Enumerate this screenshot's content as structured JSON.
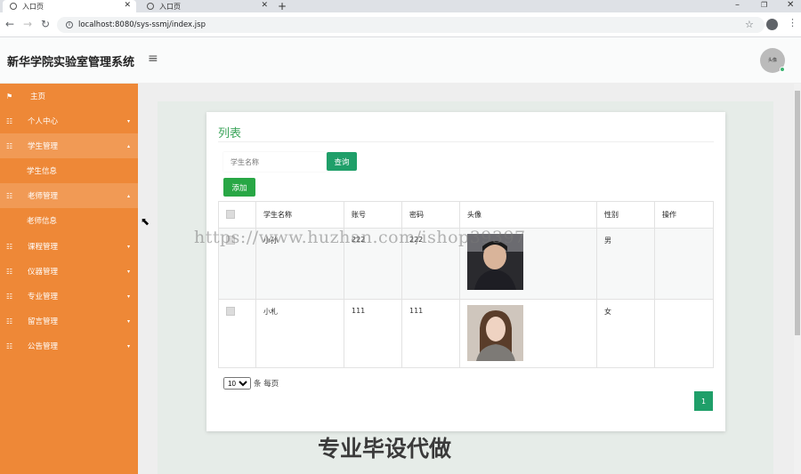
{
  "browser": {
    "tabs": [
      {
        "title": "入口页"
      },
      {
        "title": "入口页"
      }
    ],
    "url": "localhost:8080/sys-ssmj/index.jsp"
  },
  "header": {
    "title": "新华学院实验室管理系统",
    "avatar_text": "头像"
  },
  "sidebar": {
    "items": [
      {
        "label": "主页"
      },
      {
        "label": "个人中心"
      },
      {
        "label": "学生管理"
      },
      {
        "label": "学生信息"
      },
      {
        "label": "老师管理"
      },
      {
        "label": "老师信息"
      },
      {
        "label": "课程管理"
      },
      {
        "label": "仪器管理"
      },
      {
        "label": "专业管理"
      },
      {
        "label": "留言管理"
      },
      {
        "label": "公告管理"
      }
    ]
  },
  "main": {
    "card_title": "列表",
    "search_placeholder": "学生名称",
    "search_button": "查询",
    "add_button": "添加",
    "table": {
      "columns": [
        "学生名称",
        "账号",
        "密码",
        "头像",
        "性别",
        "操作"
      ],
      "rows": [
        {
          "name": "小孙",
          "account": "222",
          "password": "222",
          "gender": "男"
        },
        {
          "name": "小札",
          "account": "111",
          "password": "111",
          "gender": "女"
        }
      ]
    },
    "page_size": "10",
    "page_size_suffix": "条 每页",
    "current_page": "1"
  },
  "watermarks": {
    "url": "https://www.huzhan.com/ishop39397",
    "slogan": "专业毕设代做"
  },
  "colors": {
    "sidebar": "#ee8837",
    "primary_green": "#1f9f69",
    "add_green": "#28a745",
    "title_green": "#3da55b"
  }
}
